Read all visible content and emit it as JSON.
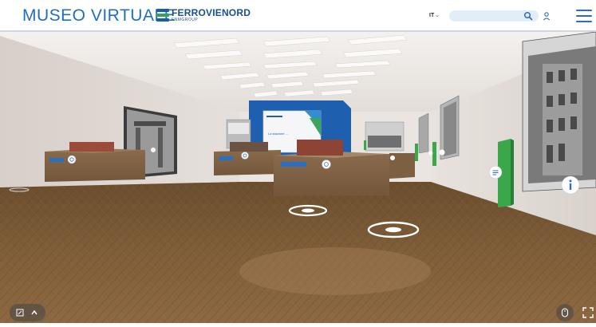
{
  "header": {
    "brand_title": "MUSEO VIRTUALE",
    "logo_name": "FERROVIENORD",
    "logo_sub": "FNMGROUP",
    "language": "IT",
    "search_placeholder": ""
  },
  "exhibit": {
    "screen_title": "La stazione ...",
    "plaque_1": "",
    "plaque_2": "",
    "plaque_3": ""
  },
  "colors": {
    "brand_blue": "#1f6fc0",
    "logo_green": "#31a35b",
    "panel_blue": "#1e5fb0",
    "floor": "#7a5a36",
    "hotspot": "#ffffff"
  },
  "icons": [
    "search-icon",
    "user-icon",
    "menu-icon",
    "info-icon",
    "chat-icon",
    "expand-icon",
    "chevron-up-icon",
    "mouse-icon",
    "fullscreen-icon"
  ]
}
